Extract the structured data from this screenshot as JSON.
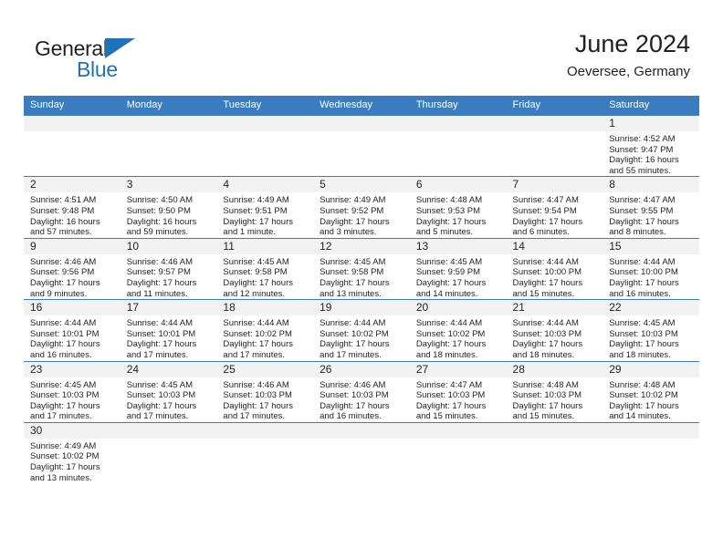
{
  "logo": {
    "word1": "General",
    "word2": "Blue",
    "triangle_color": "#1f72b8",
    "text_color": "#231f20"
  },
  "header": {
    "title": "June 2024",
    "subtitle": "Oeversee, Germany"
  },
  "theme": {
    "header_row_bg": "#3a7cc0",
    "header_row_text": "#ffffff",
    "daynum_band_bg": "#f2f2f2",
    "cell_bg": "#ffffff",
    "grid_line": "#3a7cc0",
    "body_text": "#231f20"
  },
  "weekdays": [
    "Sunday",
    "Monday",
    "Tuesday",
    "Wednesday",
    "Thursday",
    "Friday",
    "Saturday"
  ],
  "labels": {
    "sunrise_prefix": "Sunrise:",
    "sunset_prefix": "Sunset:",
    "daylight_prefix": "Daylight:"
  },
  "weeks": [
    [
      {
        "blank": true
      },
      {
        "blank": true
      },
      {
        "blank": true
      },
      {
        "blank": true
      },
      {
        "blank": true
      },
      {
        "blank": true
      },
      {
        "day": "1",
        "sunrise": "Sunrise: 4:52 AM",
        "sunset": "Sunset: 9:47 PM",
        "daylight1": "Daylight: 16 hours",
        "daylight2": "and 55 minutes."
      }
    ],
    [
      {
        "day": "2",
        "sunrise": "Sunrise: 4:51 AM",
        "sunset": "Sunset: 9:48 PM",
        "daylight1": "Daylight: 16 hours",
        "daylight2": "and 57 minutes."
      },
      {
        "day": "3",
        "sunrise": "Sunrise: 4:50 AM",
        "sunset": "Sunset: 9:50 PM",
        "daylight1": "Daylight: 16 hours",
        "daylight2": "and 59 minutes."
      },
      {
        "day": "4",
        "sunrise": "Sunrise: 4:49 AM",
        "sunset": "Sunset: 9:51 PM",
        "daylight1": "Daylight: 17 hours",
        "daylight2": "and 1 minute."
      },
      {
        "day": "5",
        "sunrise": "Sunrise: 4:49 AM",
        "sunset": "Sunset: 9:52 PM",
        "daylight1": "Daylight: 17 hours",
        "daylight2": "and 3 minutes."
      },
      {
        "day": "6",
        "sunrise": "Sunrise: 4:48 AM",
        "sunset": "Sunset: 9:53 PM",
        "daylight1": "Daylight: 17 hours",
        "daylight2": "and 5 minutes."
      },
      {
        "day": "7",
        "sunrise": "Sunrise: 4:47 AM",
        "sunset": "Sunset: 9:54 PM",
        "daylight1": "Daylight: 17 hours",
        "daylight2": "and 6 minutes."
      },
      {
        "day": "8",
        "sunrise": "Sunrise: 4:47 AM",
        "sunset": "Sunset: 9:55 PM",
        "daylight1": "Daylight: 17 hours",
        "daylight2": "and 8 minutes."
      }
    ],
    [
      {
        "day": "9",
        "sunrise": "Sunrise: 4:46 AM",
        "sunset": "Sunset: 9:56 PM",
        "daylight1": "Daylight: 17 hours",
        "daylight2": "and 9 minutes."
      },
      {
        "day": "10",
        "sunrise": "Sunrise: 4:46 AM",
        "sunset": "Sunset: 9:57 PM",
        "daylight1": "Daylight: 17 hours",
        "daylight2": "and 11 minutes."
      },
      {
        "day": "11",
        "sunrise": "Sunrise: 4:45 AM",
        "sunset": "Sunset: 9:58 PM",
        "daylight1": "Daylight: 17 hours",
        "daylight2": "and 12 minutes."
      },
      {
        "day": "12",
        "sunrise": "Sunrise: 4:45 AM",
        "sunset": "Sunset: 9:58 PM",
        "daylight1": "Daylight: 17 hours",
        "daylight2": "and 13 minutes."
      },
      {
        "day": "13",
        "sunrise": "Sunrise: 4:45 AM",
        "sunset": "Sunset: 9:59 PM",
        "daylight1": "Daylight: 17 hours",
        "daylight2": "and 14 minutes."
      },
      {
        "day": "14",
        "sunrise": "Sunrise: 4:44 AM",
        "sunset": "Sunset: 10:00 PM",
        "daylight1": "Daylight: 17 hours",
        "daylight2": "and 15 minutes."
      },
      {
        "day": "15",
        "sunrise": "Sunrise: 4:44 AM",
        "sunset": "Sunset: 10:00 PM",
        "daylight1": "Daylight: 17 hours",
        "daylight2": "and 16 minutes."
      }
    ],
    [
      {
        "day": "16",
        "sunrise": "Sunrise: 4:44 AM",
        "sunset": "Sunset: 10:01 PM",
        "daylight1": "Daylight: 17 hours",
        "daylight2": "and 16 minutes."
      },
      {
        "day": "17",
        "sunrise": "Sunrise: 4:44 AM",
        "sunset": "Sunset: 10:01 PM",
        "daylight1": "Daylight: 17 hours",
        "daylight2": "and 17 minutes."
      },
      {
        "day": "18",
        "sunrise": "Sunrise: 4:44 AM",
        "sunset": "Sunset: 10:02 PM",
        "daylight1": "Daylight: 17 hours",
        "daylight2": "and 17 minutes."
      },
      {
        "day": "19",
        "sunrise": "Sunrise: 4:44 AM",
        "sunset": "Sunset: 10:02 PM",
        "daylight1": "Daylight: 17 hours",
        "daylight2": "and 17 minutes."
      },
      {
        "day": "20",
        "sunrise": "Sunrise: 4:44 AM",
        "sunset": "Sunset: 10:02 PM",
        "daylight1": "Daylight: 17 hours",
        "daylight2": "and 18 minutes."
      },
      {
        "day": "21",
        "sunrise": "Sunrise: 4:44 AM",
        "sunset": "Sunset: 10:03 PM",
        "daylight1": "Daylight: 17 hours",
        "daylight2": "and 18 minutes."
      },
      {
        "day": "22",
        "sunrise": "Sunrise: 4:45 AM",
        "sunset": "Sunset: 10:03 PM",
        "daylight1": "Daylight: 17 hours",
        "daylight2": "and 18 minutes."
      }
    ],
    [
      {
        "day": "23",
        "sunrise": "Sunrise: 4:45 AM",
        "sunset": "Sunset: 10:03 PM",
        "daylight1": "Daylight: 17 hours",
        "daylight2": "and 17 minutes."
      },
      {
        "day": "24",
        "sunrise": "Sunrise: 4:45 AM",
        "sunset": "Sunset: 10:03 PM",
        "daylight1": "Daylight: 17 hours",
        "daylight2": "and 17 minutes."
      },
      {
        "day": "25",
        "sunrise": "Sunrise: 4:46 AM",
        "sunset": "Sunset: 10:03 PM",
        "daylight1": "Daylight: 17 hours",
        "daylight2": "and 17 minutes."
      },
      {
        "day": "26",
        "sunrise": "Sunrise: 4:46 AM",
        "sunset": "Sunset: 10:03 PM",
        "daylight1": "Daylight: 17 hours",
        "daylight2": "and 16 minutes."
      },
      {
        "day": "27",
        "sunrise": "Sunrise: 4:47 AM",
        "sunset": "Sunset: 10:03 PM",
        "daylight1": "Daylight: 17 hours",
        "daylight2": "and 15 minutes."
      },
      {
        "day": "28",
        "sunrise": "Sunrise: 4:48 AM",
        "sunset": "Sunset: 10:03 PM",
        "daylight1": "Daylight: 17 hours",
        "daylight2": "and 15 minutes."
      },
      {
        "day": "29",
        "sunrise": "Sunrise: 4:48 AM",
        "sunset": "Sunset: 10:02 PM",
        "daylight1": "Daylight: 17 hours",
        "daylight2": "and 14 minutes."
      }
    ],
    [
      {
        "day": "30",
        "sunrise": "Sunrise: 4:49 AM",
        "sunset": "Sunset: 10:02 PM",
        "daylight1": "Daylight: 17 hours",
        "daylight2": "and 13 minutes."
      },
      {
        "blank": true
      },
      {
        "blank": true
      },
      {
        "blank": true
      },
      {
        "blank": true
      },
      {
        "blank": true
      },
      {
        "blank": true
      }
    ]
  ]
}
